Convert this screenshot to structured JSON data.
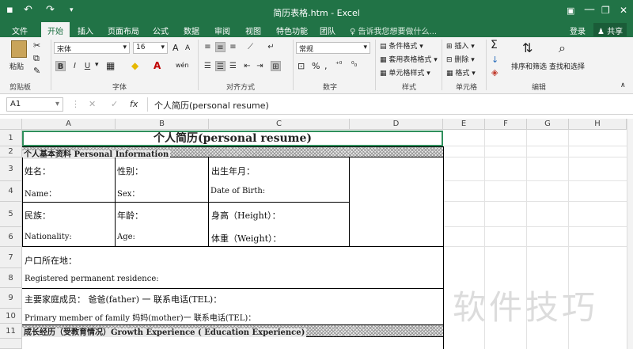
{
  "window": {
    "title": "简历表格.htm - Excel",
    "save_icon": "save-icon",
    "minimize": "—",
    "restore": "❐",
    "close": "✕",
    "ribbon_opts": "▣"
  },
  "tabs": [
    "文件",
    "开始",
    "插入",
    "页面布局",
    "公式",
    "数据",
    "审阅",
    "视图",
    "特色功能",
    "团队"
  ],
  "active_tab": "开始",
  "tellme": "告诉我您想要做什么...",
  "login": "登录",
  "share": "共享",
  "ribbon": {
    "clipboard": {
      "paste": "粘贴",
      "label": "剪贴板"
    },
    "font": {
      "name": "宋体",
      "size": "16",
      "bold": "B",
      "italic": "I",
      "underline": "U",
      "label": "字体",
      "grow": "A",
      "shrink": "A",
      "font_color": "A",
      "wen": "wén"
    },
    "alignment": {
      "label": "对齐方式"
    },
    "number": {
      "format": "常规",
      "label": "数字",
      "percent": "%",
      "comma": ","
    },
    "styles": {
      "conditional": "条件格式",
      "table": "套用表格格式",
      "cell": "单元格样式",
      "label": "样式"
    },
    "cells": {
      "insert": "插入",
      "delete": "删除",
      "format": "格式",
      "label": "单元格"
    },
    "editing": {
      "sort": "排序和筛选",
      "find": "查找和选择",
      "label": "编辑",
      "sigma": "Σ"
    }
  },
  "formula_bar": {
    "cell_ref": "A1",
    "cancel": "✕",
    "enter": "✓",
    "fx": "fx",
    "content": "个人简历(personal resume)"
  },
  "columns": [
    "A",
    "B",
    "C",
    "D",
    "E",
    "F",
    "G",
    "H"
  ],
  "rows": [
    "1",
    "2",
    "3",
    "4",
    "5",
    "6",
    "7",
    "8",
    "9",
    "10",
    "11"
  ],
  "sheet": {
    "title": "个人简历(personal resume)",
    "section1": "个人基本资料  Personal  Information",
    "name_cn": "姓名：",
    "name_en": "Name：",
    "gender_cn": "性别：",
    "gender_en": "Sex：",
    "birth_cn": "出生年月：",
    "birth_en": "Date of Birth:",
    "ethnic_cn": "民族：",
    "ethnic_en": "Nationality:",
    "age_cn": "年龄：",
    "age_en": "Age:",
    "height": "身高（Height）：",
    "weight": "体重（Weight）：",
    "hukou_cn": "户口所在地：",
    "hukou_en": "Registered permanent residence:",
    "family_cn": "主要家庭成员：        爸爸(father) 一    联系电话(TEL)：",
    "family_en": "Primary member of family  妈妈(mother)一    联系电话(TEL)：",
    "section2": "成长经历（受教育情况）Growth Experience ( Education Experience)"
  },
  "watermark": "软件技巧"
}
